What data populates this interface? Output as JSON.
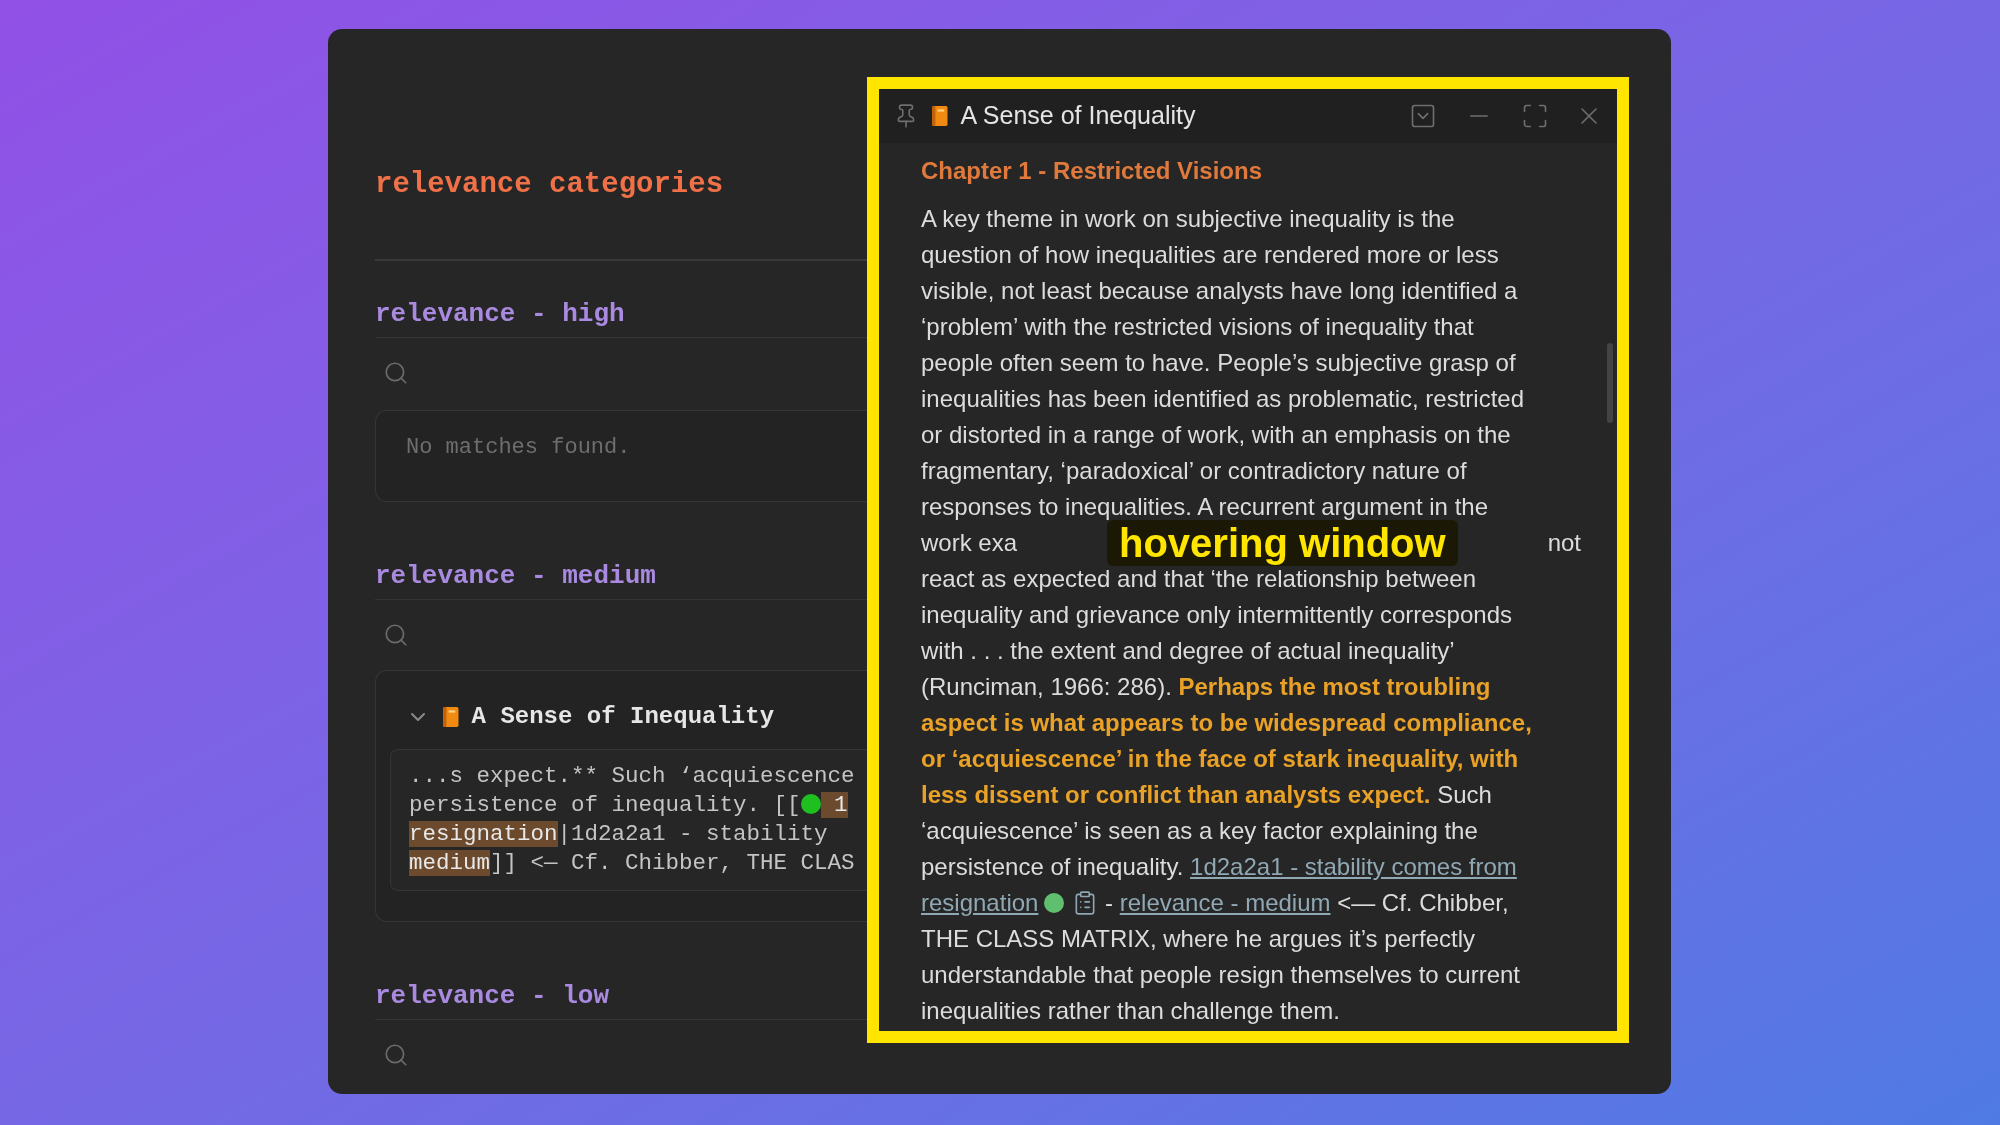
{
  "sidebar": {
    "title": "relevance categories",
    "sections": [
      {
        "heading": "relevance - high",
        "results": {
          "kind": "empty",
          "message": "No matches found."
        }
      },
      {
        "heading": "relevance - medium",
        "results": {
          "kind": "matches",
          "files": [
            {
              "title": "A Sense of Inequality",
              "expanded": true,
              "snippet_lines": [
                [
                  {
                    "kind": "text",
                    "text": "...s expect.** Such ‘acquiescence"
                  }
                ],
                [
                  {
                    "kind": "text",
                    "text": "persistence of inequality. [["
                  },
                  {
                    "kind": "status_dot",
                    "color": "#1fbf1f"
                  },
                  {
                    "kind": "match",
                    "text": " 1"
                  }
                ],
                [
                  {
                    "kind": "match",
                    "text": "resignation"
                  },
                  {
                    "kind": "text",
                    "text": "|1d2a2a1 - stability"
                  }
                ],
                [
                  {
                    "kind": "match",
                    "text": "medium"
                  },
                  {
                    "kind": "text",
                    "text": "]] <— Cf. Chibber, THE CLAS"
                  }
                ]
              ]
            }
          ]
        }
      },
      {
        "heading": "relevance - low"
      }
    ]
  },
  "hover_window": {
    "title": "A Sense of Inequality",
    "heading": "Chapter 1 - Restricted Visions",
    "lines": [
      [
        {
          "kind": "text",
          "text": "A key theme in work on subjective inequality is the"
        }
      ],
      [
        {
          "kind": "text",
          "text": "question of how inequalities are rendered more or less"
        }
      ],
      [
        {
          "kind": "text",
          "text": "visible, not least because analysts have long identified a"
        }
      ],
      [
        {
          "kind": "text",
          "text": "‘problem’ with the restricted visions of inequality that"
        }
      ],
      [
        {
          "kind": "text",
          "text": "people often seem to have. People’s subjective grasp of"
        }
      ],
      [
        {
          "kind": "text",
          "text": "inequalities has been identified as problematic, restricted"
        }
      ],
      [
        {
          "kind": "text",
          "text": "or distorted in a range of work, with an emphasis on the"
        }
      ],
      [
        {
          "kind": "text",
          "text": "fragmentary, ‘paradoxical’ or contradictory nature of"
        }
      ],
      [
        {
          "kind": "text",
          "text": "responses to inequalities. A recurrent argument in the"
        }
      ],
      [
        {
          "kind": "text",
          "text": "work exa"
        },
        {
          "kind": "covered"
        },
        {
          "kind": "text",
          "text": "not"
        }
      ],
      [
        {
          "kind": "text",
          "text": "react as expected and that ‘the relationship between"
        }
      ],
      [
        {
          "kind": "text",
          "text": "inequality and grievance only intermittently corresponds"
        }
      ],
      [
        {
          "kind": "text",
          "text": "with . . . the extent and degree of actual inequality’"
        }
      ],
      [
        {
          "kind": "text",
          "text": "(Runciman, 1966: 286). "
        },
        {
          "kind": "highlight",
          "text": "Perhaps the most troubling"
        }
      ],
      [
        {
          "kind": "highlight",
          "text": "aspect is what appears to be widespread compliance,"
        }
      ],
      [
        {
          "kind": "highlight",
          "text": "or ‘acquiescence’ in the face of stark inequality, with"
        }
      ],
      [
        {
          "kind": "highlight",
          "text": "less dissent or conflict than analysts expect."
        },
        {
          "kind": "text",
          "text": " Such"
        }
      ],
      [
        {
          "kind": "text",
          "text": "‘acquiescence’ is seen as a key factor explaining the"
        }
      ],
      [
        {
          "kind": "text",
          "text": "persistence of inequality. "
        },
        {
          "kind": "link",
          "text": "1d2a2a1 - stability comes from"
        }
      ],
      [
        {
          "kind": "link",
          "text": "resignation"
        },
        {
          "kind": "status_dot",
          "color": "#5fbf6f"
        },
        {
          "kind": "doc_icon"
        },
        {
          "kind": "text",
          "text": " - "
        },
        {
          "kind": "link",
          "text": "relevance - medium"
        },
        {
          "kind": "text",
          "text": " <— Cf. Chibber,"
        }
      ],
      [
        {
          "kind": "text",
          "text": "THE CLASS MATRIX, where he argues it’s perfectly"
        }
      ],
      [
        {
          "kind": "text",
          "text": "understandable that people resign themselves to current"
        }
      ],
      [
        {
          "kind": "text",
          "text": "inequalities rather than challenge them."
        }
      ]
    ]
  },
  "caption": "hovering window"
}
